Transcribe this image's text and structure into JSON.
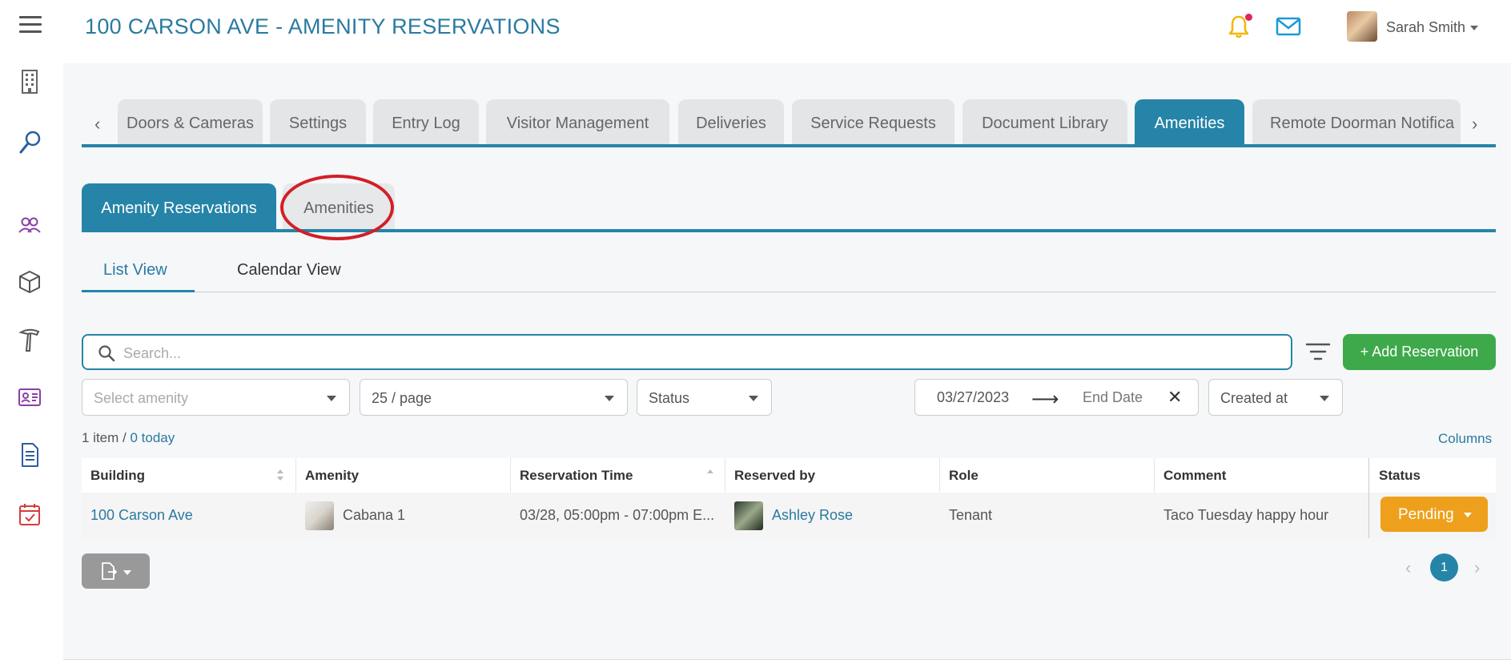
{
  "header": {
    "title": "100 CARSON AVE - AMENITY RESERVATIONS",
    "user_name": "Sarah Smith"
  },
  "sidebar": {
    "items": [
      {
        "icon": "building-icon"
      },
      {
        "icon": "search-icon"
      },
      {
        "icon": "users-icon"
      },
      {
        "icon": "package-icon"
      },
      {
        "icon": "hammer-icon"
      },
      {
        "icon": "id-card-icon"
      },
      {
        "icon": "document-icon"
      },
      {
        "icon": "calendar-check-icon"
      }
    ]
  },
  "top_tabs": [
    {
      "label": "Doors & Cameras",
      "active": false
    },
    {
      "label": "Settings",
      "active": false
    },
    {
      "label": "Entry Log",
      "active": false
    },
    {
      "label": "Visitor Management",
      "active": false
    },
    {
      "label": "Deliveries",
      "active": false
    },
    {
      "label": "Service Requests",
      "active": false
    },
    {
      "label": "Document Library",
      "active": false
    },
    {
      "label": "Amenities",
      "active": true
    },
    {
      "label": "Remote Doorman Notifica",
      "active": false
    }
  ],
  "sub_tabs": [
    {
      "label": "Amenity Reservations",
      "active": true
    },
    {
      "label": "Amenities",
      "active": false
    }
  ],
  "view_tabs": [
    {
      "label": "List View",
      "active": true
    },
    {
      "label": "Calendar View",
      "active": false
    }
  ],
  "search": {
    "placeholder": "Search...",
    "value": ""
  },
  "add_button": "+ Add Reservation",
  "filters": {
    "amenity_placeholder": "Select amenity",
    "page_size": "25 / page",
    "status": "Status",
    "start_date": "03/27/2023",
    "end_date": "End Date",
    "sort": "Created at"
  },
  "summary": {
    "items": "1 item",
    "separator": " / ",
    "today": "0 today"
  },
  "columns_link": "Columns",
  "table": {
    "headers": [
      "Building",
      "Amenity",
      "Reservation Time",
      "Reserved by",
      "Role",
      "Comment",
      "Status"
    ],
    "rows": [
      {
        "building": "100 Carson Ave",
        "amenity": "Cabana 1",
        "reservation_time": "03/28, 05:00pm - 07:00pm E...",
        "reserved_by": "Ashley Rose",
        "role": "Tenant",
        "comment": "Taco Tuesday happy hour",
        "status": "Pending"
      }
    ]
  },
  "pagination": {
    "current": "1"
  },
  "colors": {
    "accent": "#2684a8",
    "add_button": "#3ea94b",
    "pending": "#eea01c",
    "annotation_circle": "#d21f26"
  }
}
